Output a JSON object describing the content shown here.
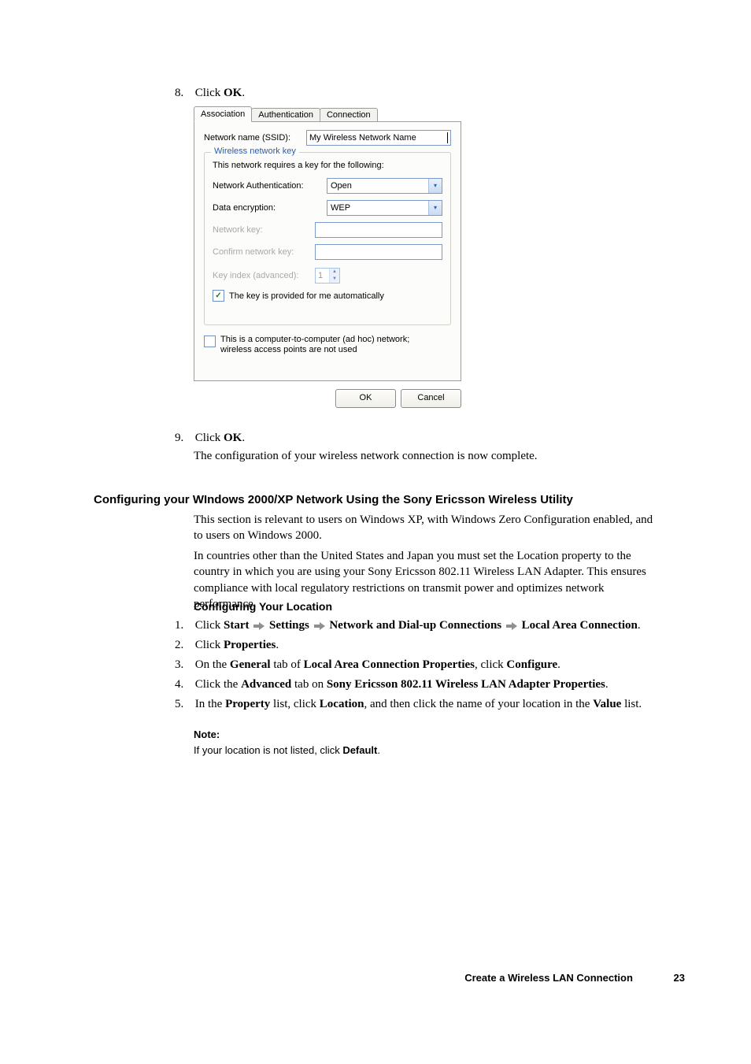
{
  "step8": {
    "num": "8.",
    "label_prefix": "Click ",
    "label_bold": "OK",
    "label_suffix": "."
  },
  "dialog": {
    "tabs": {
      "association": "Association",
      "authentication": "Authentication",
      "connection": "Connection"
    },
    "ssid_label": "Network name (SSID):",
    "ssid_value": "My Wireless Network Name",
    "fieldset_legend": "Wireless network key",
    "fieldset_intro": "This network requires a key for the following:",
    "auth_label": "Network Authentication:",
    "auth_value": "Open",
    "enc_label": "Data encryption:",
    "enc_value": "WEP",
    "netkey_label": "Network key:",
    "confirm_label": "Confirm network key:",
    "keyindex_label": "Key index (advanced):",
    "keyindex_value": "1",
    "autokey_label": "The key is provided for me automatically",
    "adhoc_label": "This is a computer-to-computer (ad hoc) network; wireless access points are not used",
    "ok": "OK",
    "cancel": "Cancel"
  },
  "step9": {
    "num": "9.",
    "label_prefix": "Click ",
    "label_bold": "OK",
    "label_suffix": "."
  },
  "step9_follow": "The configuration of your wireless network connection is now complete.",
  "h2": "Configuring your WIndows 2000/XP Network Using the Sony Ericsson Wireless Utility",
  "para1": "This section is relevant to users on Windows XP, with Windows Zero Configuration enabled, and to users on Windows 2000.",
  "para2": "In countries other than the United States and Japan you must set the Location property to the country in which you are using your Sony Ericsson 802.11 Wireless LAN Adapter. This ensures compliance with local regulatory restrictions on transmit power and optimizes network performance.",
  "h3": "Configuring Your Location",
  "steps2": {
    "s1": {
      "num": "1.",
      "pre": "Click ",
      "b1": "Start",
      "b2": "Settings",
      "b3": "Network and Dial-up Connections",
      "b4": "Local Area Connection",
      "suf": "."
    },
    "s2": {
      "num": "2.",
      "pre": "Click ",
      "b1": "Properties",
      "suf": "."
    },
    "s3": {
      "num": "3.",
      "pre": "On the ",
      "b1": "General",
      "mid1": " tab of ",
      "b2": "Local Area Connection Properties",
      "mid2": ", click ",
      "b3": "Configure",
      "suf": "."
    },
    "s4": {
      "num": "4.",
      "pre": "Click the ",
      "b1": "Advanced",
      "mid1": " tab on ",
      "b2": "Sony Ericsson 802.11 Wireless LAN Adapter Properties",
      "suf": "."
    },
    "s5": {
      "num": "5.",
      "pre": "In the ",
      "b1": "Property",
      "mid1": " list, click ",
      "b2": "Location",
      "mid2": ", and then click the name of your location in the ",
      "b3": "Value",
      "suf": " list."
    }
  },
  "note": {
    "title": "Note:",
    "pre": "If your location is not listed, click ",
    "b": "Default",
    "suf": "."
  },
  "footer": {
    "title": "Create a Wireless LAN Connection",
    "page": "23"
  }
}
